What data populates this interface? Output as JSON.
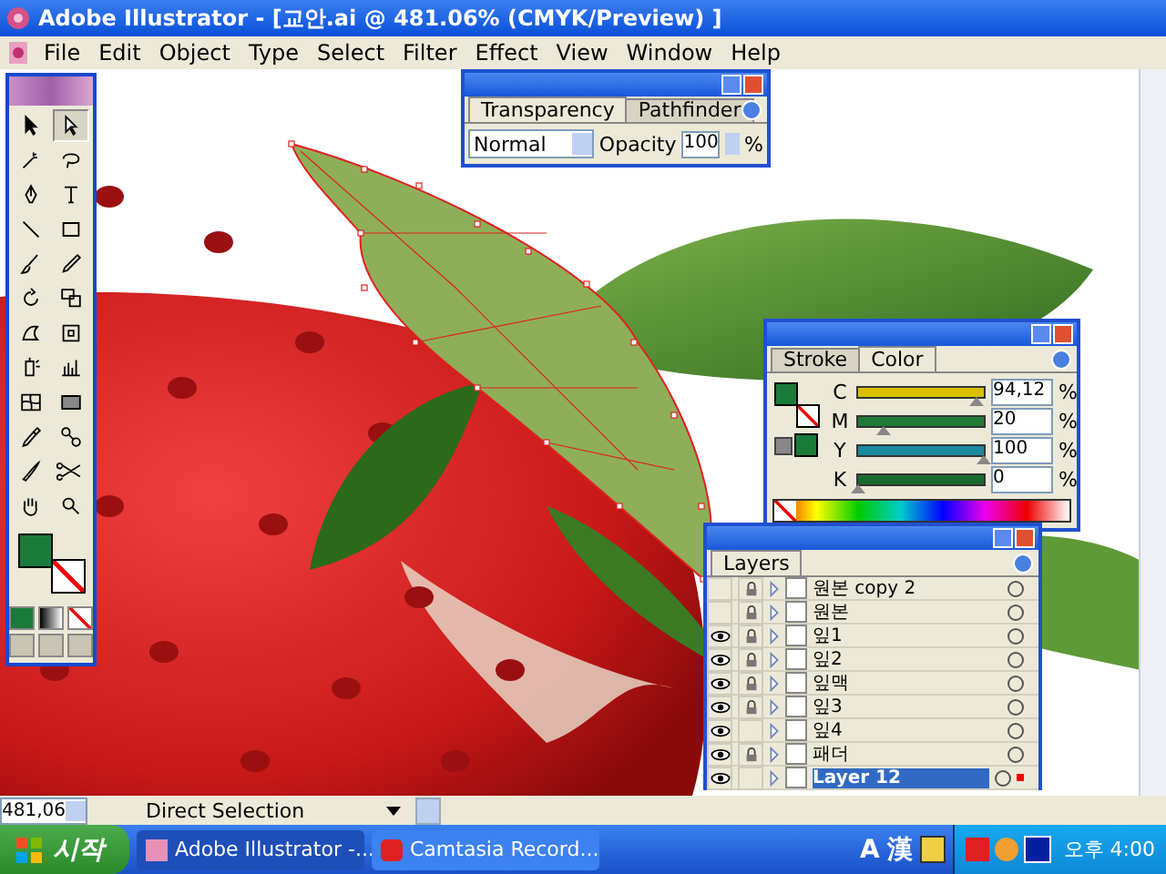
{
  "window": {
    "title": "Adobe Illustrator - [교안.ai @ 481.06% (CMYK/Preview) ]"
  },
  "menu": [
    "File",
    "Edit",
    "Object",
    "Type",
    "Select",
    "Filter",
    "Effect",
    "View",
    "Window",
    "Help"
  ],
  "toolbox": {
    "tools": [
      {
        "kind": "selection",
        "selected": false
      },
      {
        "kind": "direct-selection",
        "selected": true
      },
      {
        "kind": "magic-wand",
        "selected": false
      },
      {
        "kind": "lasso",
        "selected": false
      },
      {
        "kind": "pen",
        "selected": false
      },
      {
        "kind": "type",
        "selected": false
      },
      {
        "kind": "line",
        "selected": false
      },
      {
        "kind": "rectangle",
        "selected": false
      },
      {
        "kind": "brush",
        "selected": false
      },
      {
        "kind": "pencil",
        "selected": false
      },
      {
        "kind": "rotate",
        "selected": false
      },
      {
        "kind": "scale",
        "selected": false
      },
      {
        "kind": "warp",
        "selected": false
      },
      {
        "kind": "free-transform",
        "selected": false
      },
      {
        "kind": "symbol-sprayer",
        "selected": false
      },
      {
        "kind": "graph",
        "selected": false
      },
      {
        "kind": "mesh",
        "selected": false
      },
      {
        "kind": "gradient",
        "selected": false
      },
      {
        "kind": "eyedropper",
        "selected": false
      },
      {
        "kind": "blend",
        "selected": false
      },
      {
        "kind": "knife",
        "selected": false
      },
      {
        "kind": "scissors",
        "selected": false
      },
      {
        "kind": "hand",
        "selected": false
      },
      {
        "kind": "zoom",
        "selected": false
      }
    ]
  },
  "transparency_panel": {
    "tabs": [
      {
        "label": "Transparency",
        "selected": true
      },
      {
        "label": "Pathfinder",
        "selected": false
      }
    ],
    "blend_mode": "Normal",
    "opacity_label": "Opacity",
    "opacity": "100",
    "unit": "%"
  },
  "color_panel": {
    "tabs": [
      {
        "label": "Stroke",
        "selected": false
      },
      {
        "label": "Color",
        "selected": true
      }
    ],
    "channels": [
      {
        "name": "C",
        "value": "94,12",
        "unit": "%",
        "level": 0.94,
        "color": "#d8c000"
      },
      {
        "name": "M",
        "value": "20",
        "unit": "%",
        "level": 0.2,
        "color": "#1f7a35"
      },
      {
        "name": "Y",
        "value": "100",
        "unit": "%",
        "level": 1.0,
        "color": "#1a8aa0"
      },
      {
        "name": "K",
        "value": "0",
        "unit": "%",
        "level": 0.0,
        "color": "#1a6a30"
      }
    ]
  },
  "layers_panel": {
    "tab": "Layers",
    "layers": [
      {
        "name": "원본 copy 2",
        "visible": false,
        "locked": true,
        "selected": false
      },
      {
        "name": "원본",
        "visible": false,
        "locked": true,
        "selected": false
      },
      {
        "name": "잎1",
        "visible": true,
        "locked": true,
        "selected": false
      },
      {
        "name": "잎2",
        "visible": true,
        "locked": true,
        "selected": false
      },
      {
        "name": "잎맥",
        "visible": true,
        "locked": true,
        "selected": false
      },
      {
        "name": "잎3",
        "visible": true,
        "locked": true,
        "selected": false
      },
      {
        "name": "잎4",
        "visible": true,
        "locked": false,
        "selected": false
      },
      {
        "name": "패더",
        "visible": true,
        "locked": true,
        "selected": false
      },
      {
        "name": "Layer 12",
        "visible": true,
        "locked": false,
        "selected": true
      }
    ]
  },
  "status_bar": {
    "zoom": "481,06",
    "tool": "Direct Selection"
  },
  "taskbar": {
    "start": "시작",
    "tasks": [
      {
        "label": "Adobe Illustrator -...",
        "selected": true
      },
      {
        "label": "Camtasia Record...",
        "selected": false
      }
    ],
    "ime": [
      "A",
      "漢"
    ],
    "clock": "오후 4:00"
  }
}
